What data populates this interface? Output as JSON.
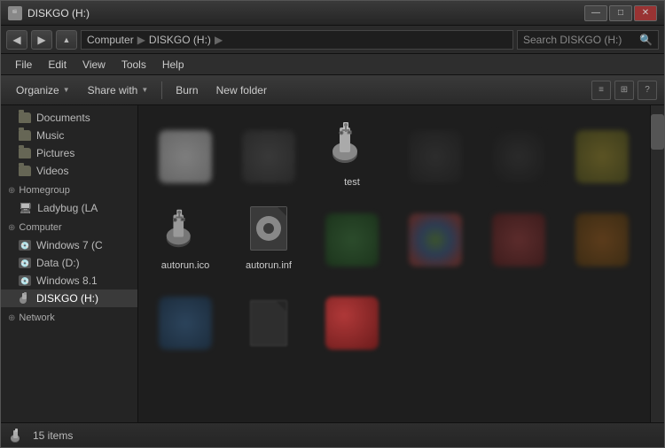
{
  "window": {
    "title": "DISKGO (H:)",
    "controls": [
      "—",
      "□",
      "✕"
    ]
  },
  "addressbar": {
    "nav_back": "◀",
    "nav_forward": "▶",
    "nav_up": "▲",
    "breadcrumb": [
      "Computer",
      "DISKGO (H:)",
      ""
    ],
    "search_placeholder": "Search DISKGO (H:)",
    "search_icon": "🔍"
  },
  "menubar": {
    "items": [
      "File",
      "Edit",
      "View",
      "Tools",
      "Help"
    ]
  },
  "toolbar": {
    "organize_label": "Organize",
    "share_label": "Share with",
    "burn_label": "Burn",
    "new_folder_label": "New folder"
  },
  "sidebar": {
    "folders": [
      {
        "name": "Documents"
      },
      {
        "name": "Music"
      },
      {
        "name": "Pictures"
      },
      {
        "name": "Videos"
      }
    ],
    "homegroup": {
      "label": "Homegroup",
      "items": [
        "Ladybug (LA"
      ]
    },
    "computer": {
      "label": "Computer",
      "items": [
        "Windows 7 (C",
        "Data (D:)",
        "Windows 8.1",
        "DISKGO (H:)"
      ]
    },
    "network": {
      "label": "Network"
    }
  },
  "files": [
    {
      "id": "file1",
      "name": "",
      "type": "blurred-white",
      "row": 0
    },
    {
      "id": "file2",
      "name": "",
      "type": "blurred-dark",
      "row": 0
    },
    {
      "id": "test",
      "name": "test",
      "type": "usb",
      "row": 0
    },
    {
      "id": "file4",
      "name": "",
      "type": "blurred-dark2",
      "row": 0
    },
    {
      "id": "file5",
      "name": "",
      "type": "blurred-dark3",
      "row": 0
    },
    {
      "id": "file6",
      "name": "",
      "type": "blurred-yellow",
      "row": 0
    },
    {
      "id": "autorun-ico",
      "name": "autorun.ico",
      "type": "usb-small",
      "row": 1
    },
    {
      "id": "autorun-inf",
      "name": "autorun.inf",
      "type": "gear-doc",
      "row": 1
    },
    {
      "id": "file9",
      "name": "",
      "type": "blurred-green",
      "row": 1
    },
    {
      "id": "file10",
      "name": "",
      "type": "blurred-multi",
      "row": 1
    },
    {
      "id": "file11",
      "name": "",
      "type": "blurred-red2",
      "row": 1
    },
    {
      "id": "file12",
      "name": "",
      "type": "blurred-orange2",
      "row": 1
    },
    {
      "id": "file13",
      "name": "",
      "type": "blurred-blue2",
      "row": 2
    },
    {
      "id": "file14",
      "name": "",
      "type": "blurred-doc",
      "row": 2
    },
    {
      "id": "file15",
      "name": "",
      "type": "blurred-red3",
      "row": 2
    }
  ],
  "statusbar": {
    "item_count": "15 items",
    "icon": "usb"
  }
}
